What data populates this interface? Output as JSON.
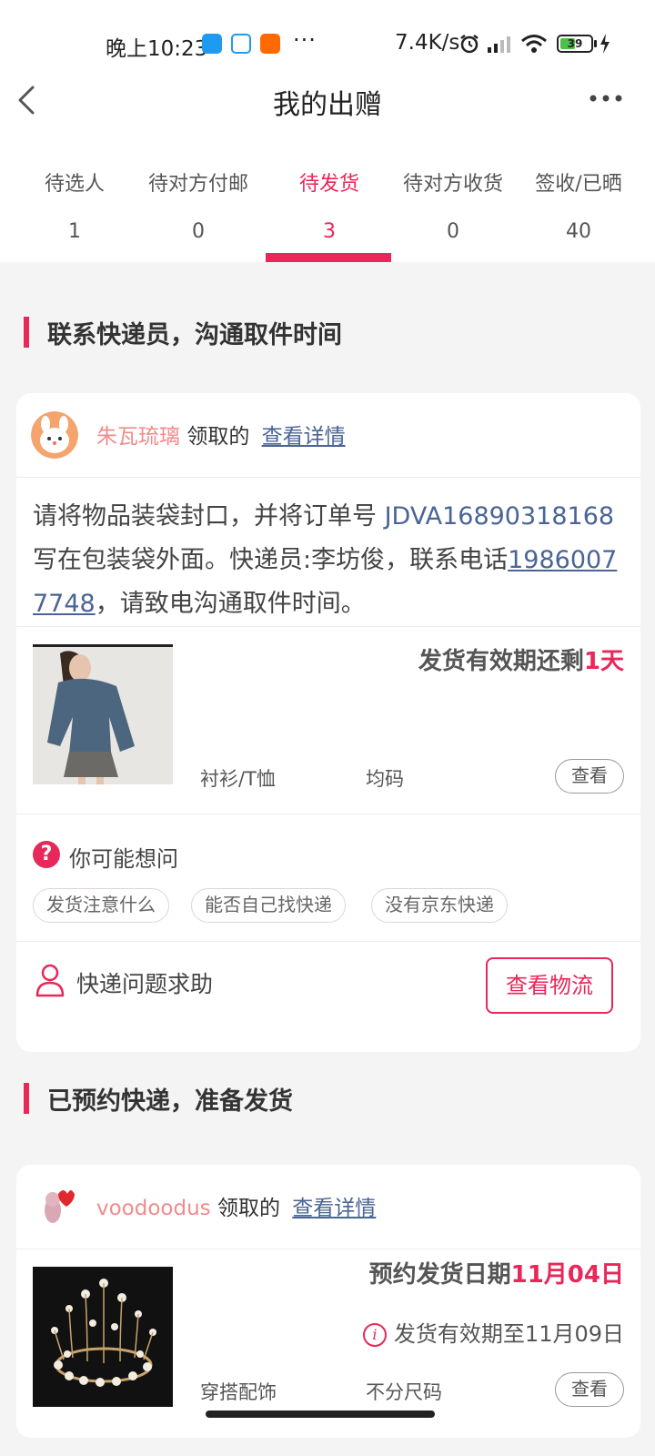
{
  "status_bar": {
    "time": "晚上10:23",
    "more_notifications": "···",
    "net_speed": "7.4K/s",
    "battery": "39"
  },
  "header": {
    "title": "我的出赠",
    "back_icon": "back-arrow-icon",
    "more_icon": "more-dots-icon"
  },
  "tabs": [
    {
      "label": "待选人",
      "count": "1"
    },
    {
      "label": "待对方付邮",
      "count": "0"
    },
    {
      "label": "待发货",
      "count": "3",
      "active": true
    },
    {
      "label": "待对方收货",
      "count": "0"
    },
    {
      "label": "签收/已晒",
      "count": "40"
    }
  ],
  "section1": {
    "title": "联系快递员，沟通取件时间",
    "card": {
      "user_name": "朱瓦琉璃",
      "received_text": "领取的",
      "detail_link": "查看详情",
      "instruction_prefix": "请将物品装袋封口，并将订单号 ",
      "order_no": "JDVA16890318168",
      "instruction_mid": " 写在包装袋外面。快递员:李坊俊，联系电话",
      "phone": "19860077748",
      "instruction_suffix": "，请致电沟通取件时间。",
      "deadline_prefix": "发货有效期还剩",
      "deadline_days": "1天",
      "category": "衬衫/T恤",
      "size": "均码",
      "view_button": "查看",
      "faq_title": "你可能想问",
      "faq_chips": [
        "发货注意什么",
        "能否自己找快递",
        "没有京东快递"
      ],
      "help_text": "快递问题求助",
      "logistics_button": "查看物流"
    }
  },
  "section2": {
    "title": "已预约快递，准备发货",
    "card": {
      "user_name": "voodoodus",
      "received_text": "领取的",
      "detail_link": "查看详情",
      "reserve_prefix": "预约发货日期",
      "reserve_date": "11月04日",
      "valid_text": "发货有效期至11月09日",
      "category": "穿搭配饰",
      "size": "不分尺码",
      "view_button": "查看"
    }
  },
  "colors": {
    "accent": "#e8275a",
    "link": "#4a6496",
    "username": "#f08c8c"
  }
}
